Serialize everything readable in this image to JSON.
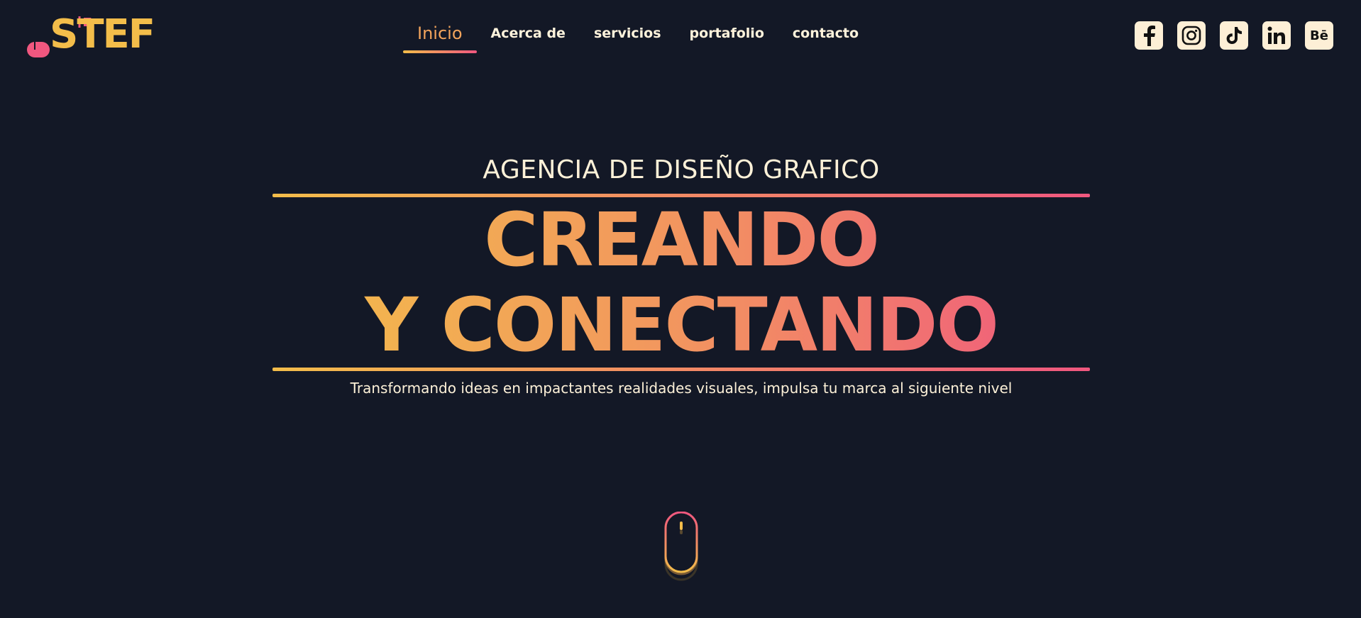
{
  "brand": {
    "logo_text": "STEF"
  },
  "nav": {
    "items": [
      {
        "label": "Inicio",
        "active": true
      },
      {
        "label": "Acerca de",
        "active": false
      },
      {
        "label": "servicios",
        "active": false
      },
      {
        "label": "portafolio",
        "active": false
      },
      {
        "label": "contacto",
        "active": false
      }
    ]
  },
  "socials": [
    {
      "icon": "facebook-icon"
    },
    {
      "icon": "instagram-icon"
    },
    {
      "icon": "tiktok-icon"
    },
    {
      "icon": "linkedin-icon"
    },
    {
      "icon": "behance-icon",
      "label": "Bē"
    }
  ],
  "hero": {
    "kicker": "AGENCIA DE DISEÑO GRAFICO",
    "headline_line1": "CREANDO",
    "headline_line2": "Y CONECTANDO",
    "subtitle": "Transformando ideas en impactantes realidades visuales, impulsa tu marca al siguiente nivel"
  },
  "scroll_indicator": {
    "icon": "scroll-mouse-icon"
  },
  "colors": {
    "background": "#131826",
    "accent_yellow": "#f3bd4a",
    "accent_pink": "#f0577f",
    "text_cream": "#fdf1d8"
  }
}
